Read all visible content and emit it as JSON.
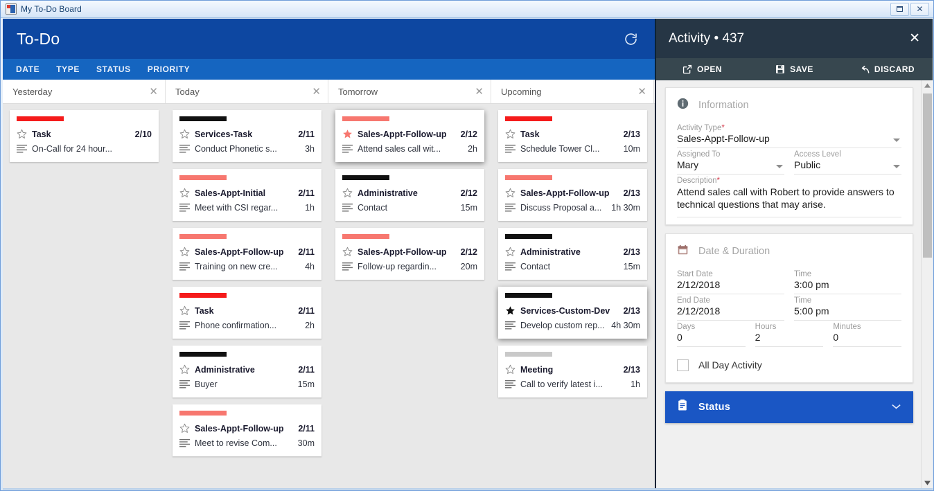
{
  "window": {
    "title": "My To-Do Board",
    "icon": "app-icon",
    "buttons": {
      "restore": "restore",
      "close": "✕"
    }
  },
  "board": {
    "title": "To-Do",
    "refresh_icon": "refresh-icon",
    "tabs": [
      "DATE",
      "TYPE",
      "STATUS",
      "PRIORITY"
    ],
    "close_glyph": "✕",
    "columns": [
      {
        "name": "Yesterday",
        "cards": [
          {
            "priority_color": "#f51b1b",
            "starred": false,
            "type": "Task",
            "date": "2/10",
            "description": "On-Call for 24 hour...",
            "duration": ""
          }
        ]
      },
      {
        "name": "Today",
        "cards": [
          {
            "priority_color": "#111111",
            "starred": false,
            "type": "Services-Task",
            "date": "2/11",
            "description": "Conduct Phonetic s...",
            "duration": "3h"
          },
          {
            "priority_color": "#f7776f",
            "starred": false,
            "type": "Sales-Appt-Initial",
            "date": "2/11",
            "description": "Meet with CSI regar...",
            "duration": "1h"
          },
          {
            "priority_color": "#f7776f",
            "starred": false,
            "type": "Sales-Appt-Follow-up",
            "date": "2/11",
            "description": "Training on new cre...",
            "duration": "4h"
          },
          {
            "priority_color": "#f51b1b",
            "starred": false,
            "type": "Task",
            "date": "2/11",
            "description": "Phone confirmation...",
            "duration": "2h"
          },
          {
            "priority_color": "#111111",
            "starred": false,
            "type": "Administrative",
            "date": "2/11",
            "description": "Buyer",
            "duration": "15m"
          },
          {
            "priority_color": "#f7776f",
            "starred": false,
            "type": "Sales-Appt-Follow-up",
            "date": "2/11",
            "description": "Meet to revise Com...",
            "duration": "30m"
          }
        ]
      },
      {
        "name": "Tomorrow",
        "cards": [
          {
            "priority_color": "#f7776f",
            "starred": true,
            "selected": true,
            "type": "Sales-Appt-Follow-up",
            "date": "2/12",
            "description": "Attend sales call wit...",
            "duration": "2h"
          },
          {
            "priority_color": "#111111",
            "starred": false,
            "type": "Administrative",
            "date": "2/12",
            "description": "Contact",
            "duration": "15m"
          },
          {
            "priority_color": "#f7776f",
            "starred": false,
            "type": "Sales-Appt-Follow-up",
            "date": "2/12",
            "description": "Follow-up regardin...",
            "duration": "20m"
          }
        ]
      },
      {
        "name": "Upcoming",
        "cards": [
          {
            "priority_color": "#f51b1b",
            "starred": false,
            "type": "Task",
            "date": "2/13",
            "description": "Schedule Tower Cl...",
            "duration": "10m"
          },
          {
            "priority_color": "#f7776f",
            "starred": false,
            "type": "Sales-Appt-Follow-up",
            "date": "2/13",
            "description": "Discuss Proposal a...",
            "duration": "1h 30m"
          },
          {
            "priority_color": "#111111",
            "starred": false,
            "type": "Administrative",
            "date": "2/13",
            "description": "Contact",
            "duration": "15m"
          },
          {
            "priority_color": "#111111",
            "starred": true,
            "selected": true,
            "type": "Services-Custom-Dev",
            "date": "2/13",
            "description": "Develop custom rep...",
            "duration": "4h 30m"
          },
          {
            "priority_color": "#c9c9c9",
            "starred": false,
            "type": "Meeting",
            "date": "2/13",
            "description": "Call to verify latest i...",
            "duration": "1h"
          }
        ]
      }
    ]
  },
  "activity": {
    "title": "Activity • 437",
    "close_glyph": "✕",
    "toolbar": [
      {
        "icon": "open-external-icon",
        "label": "OPEN"
      },
      {
        "icon": "save-floppy-icon",
        "label": "SAVE"
      },
      {
        "icon": "undo-arrow-icon",
        "label": "DISCARD"
      }
    ],
    "information": {
      "icon": "info-icon",
      "heading": "Information",
      "activity_type": {
        "label": "Activity Type",
        "required": true,
        "value": "Sales-Appt-Follow-up"
      },
      "assigned_to": {
        "label": "Assigned To",
        "required": false,
        "value": "Mary"
      },
      "access_level": {
        "label": "Access Level",
        "required": false,
        "value": "Public"
      },
      "description": {
        "label": "Description",
        "required": true,
        "value": "Attend sales call with Robert to provide answers to technical questions that may arise."
      }
    },
    "date_duration": {
      "icon": "calendar-icon",
      "heading": "Date & Duration",
      "start_date": {
        "label": "Start Date",
        "value": "2/12/2018"
      },
      "start_time": {
        "label": "Time",
        "value": "3:00 pm"
      },
      "end_date": {
        "label": "End Date",
        "value": "2/12/2018"
      },
      "end_time": {
        "label": "Time",
        "value": "5:00 pm"
      },
      "days": {
        "label": "Days",
        "value": "0"
      },
      "hours": {
        "label": "Hours",
        "value": "2"
      },
      "minutes": {
        "label": "Minutes",
        "value": "0"
      },
      "all_day": {
        "label": "All Day Activity",
        "checked": false
      }
    },
    "status_section": {
      "icon": "clipboard-icon",
      "label": "Status",
      "caret": "chevron-down-icon"
    }
  },
  "colors": {
    "board_header": "#0d47a1",
    "board_tabs": "#1565c0",
    "activity_header": "#263645",
    "activity_toolbar": "#37474f",
    "status_blue": "#1a56c4"
  }
}
